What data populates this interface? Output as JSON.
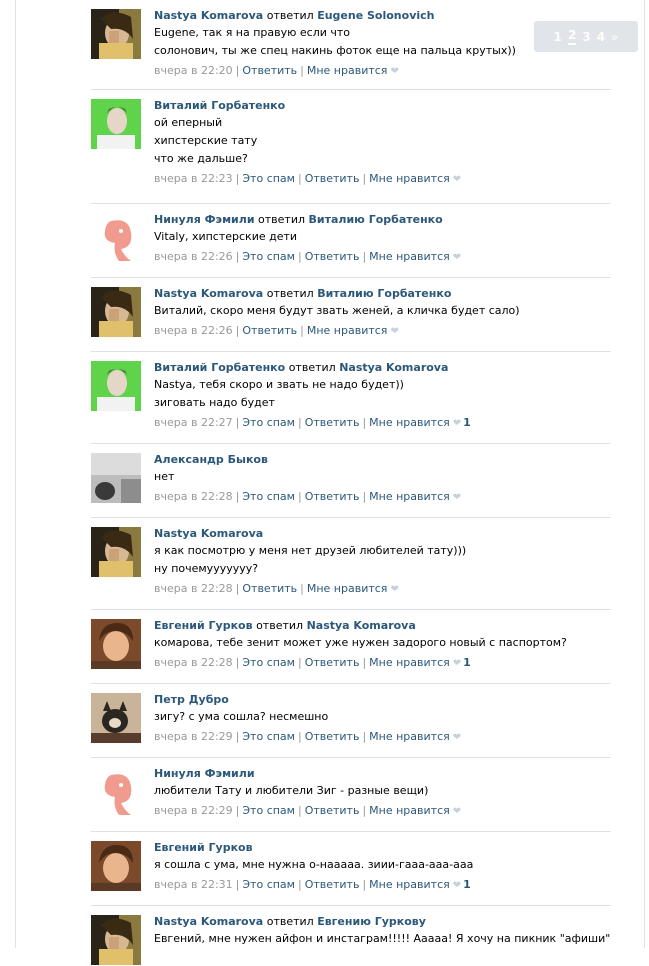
{
  "pager": {
    "pages": [
      "1",
      "2",
      "3",
      "4"
    ],
    "current": "2",
    "next": "»"
  },
  "comments": [
    {
      "author": "Nastya Komarova",
      "verb": "ответил",
      "target": "Eugene Solonovich",
      "text": "Eugene, так я на правую если что\nсолонович, ты же спец накинь фоток еще на пальца крутых))",
      "time": "вчера в 22:20",
      "spam": "",
      "reply": "Ответить",
      "like": "Мне нравится",
      "likes": "",
      "avatar": "nastya-avatar"
    },
    {
      "author": "Виталий Горбатенко",
      "verb": "",
      "target": "",
      "text": "ой еперный\nхипстерские тату\nчто же дальше?",
      "time": "вчера в 22:23",
      "spam": "Это спам",
      "reply": "Ответить",
      "like": "Мне нравится",
      "likes": "",
      "avatar": "vitaly-avatar"
    },
    {
      "author": "Нинуля Фэмили",
      "verb": "ответил",
      "target": "Виталию Горбатенко",
      "text": "Vitaly, хипстерские дети",
      "time": "вчера в 22:26",
      "spam": "Это спам",
      "reply": "Ответить",
      "like": "Мне нравится",
      "likes": "",
      "avatar": "ninulya-avatar"
    },
    {
      "author": "Nastya Komarova",
      "verb": "ответил",
      "target": "Виталию Горбатенко",
      "text": "Виталий, скоро меня будут звать женей, а кличка будет сало)",
      "time": "вчера в 22:26",
      "spam": "",
      "reply": "Ответить",
      "like": "Мне нравится",
      "likes": "",
      "avatar": "nastya-avatar"
    },
    {
      "author": "Виталий Горбатенко",
      "verb": "ответил",
      "target": "Nastya Komarova",
      "text": "Nastya, тебя скоро и звать не надо будет))\nзиговать надо будет",
      "time": "вчера в 22:27",
      "spam": "Это спам",
      "reply": "Ответить",
      "like": "Мне нравится",
      "likes": "1",
      "avatar": "vitaly-avatar"
    },
    {
      "author": "Александр Быков",
      "verb": "",
      "target": "",
      "text": "нет",
      "time": "вчера в 22:28",
      "spam": "Это спам",
      "reply": "Ответить",
      "like": "Мне нравится",
      "likes": "",
      "avatar": "alexander-avatar"
    },
    {
      "author": "Nastya Komarova",
      "verb": "",
      "target": "",
      "text": "я как посмотрю у меня нет друзей любителей тату)))\nну почемууууууу?",
      "time": "вчера в 22:28",
      "spam": "",
      "reply": "Ответить",
      "like": "Мне нравится",
      "likes": "",
      "avatar": "nastya-avatar"
    },
    {
      "author": "Евгений Гурков",
      "verb": "ответил",
      "target": "Nastya Komarova",
      "text": "комарова, тебе зенит может уже нужен задорого новый с паспортом?",
      "time": "вчера в 22:28",
      "spam": "Это спам",
      "reply": "Ответить",
      "like": "Мне нравится",
      "likes": "1",
      "avatar": "evgeny-avatar"
    },
    {
      "author": "Петр Дубро",
      "verb": "",
      "target": "",
      "text": "зигу? с ума сошла? несмешно",
      "time": "вчера в 22:29",
      "spam": "Это спам",
      "reply": "Ответить",
      "like": "Мне нравится",
      "likes": "",
      "avatar": "petr-avatar"
    },
    {
      "author": "Нинуля Фэмили",
      "verb": "",
      "target": "",
      "text": "любители Тату и любители Зиг - разные вещи)",
      "time": "вчера в 22:29",
      "spam": "Это спам",
      "reply": "Ответить",
      "like": "Мне нравится",
      "likes": "",
      "avatar": "ninulya-avatar"
    },
    {
      "author": "Евгений Гурков",
      "verb": "",
      "target": "",
      "text": "я сошла с ума, мне нужна о-нааааа. зиии-гааа-ааа-ааа",
      "time": "вчера в 22:31",
      "spam": "Это спам",
      "reply": "Ответить",
      "like": "Мне нравится",
      "likes": "1",
      "avatar": "evgeny-avatar"
    },
    {
      "author": "Nastya Komarova",
      "verb": "ответил",
      "target": "Евгению Гуркову",
      "text": "Евгений, мне нужен айфон и инстаграм!!!!! Ааааа! Я хочу на пикник \"афиши\"",
      "time": "",
      "spam": "",
      "reply": "",
      "like": "",
      "likes": "",
      "avatar": "nastya-avatar"
    }
  ]
}
